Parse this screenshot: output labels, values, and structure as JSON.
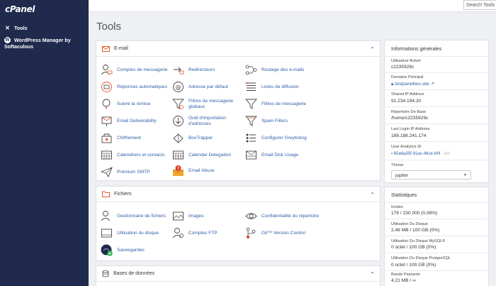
{
  "sidebar": {
    "logo": "cPanel",
    "items": [
      {
        "label": "Tools"
      },
      {
        "label": "WordPress Manager by Softaculous"
      }
    ]
  },
  "search": {
    "text": "Search Tools ("
  },
  "page": {
    "title": "Tools"
  },
  "email_section": {
    "title": "E-mail",
    "tools": [
      "Comptes de messagerie",
      "Redirecteurs",
      "Routage des e-mails",
      "Réponses automatiques",
      "Adresse par défaut",
      "Listes de diffusion",
      "Suivre la remise",
      "Filtres de messagerie globaux",
      "Filtres de messagerie",
      "Email Deliverability",
      "Outil d'importation d'adresses",
      "Spam Filters",
      "Chiffrement",
      "BoxTrapper",
      "Configurer Greylisting",
      "Calendriers et contacts",
      "Calendar Delegation",
      "Email Disk Usage",
      "Premium SMTP",
      "Email Abuse"
    ]
  },
  "files_section": {
    "title": "Fichiers",
    "tools": [
      "Gestionnaire de fichiers",
      "Images",
      "Confidentialité du répertoire",
      "Utilisation du disque",
      "Comptes FTP",
      "Git™ Version Control",
      "Sauvegardes"
    ]
  },
  "db_section": {
    "title": "Bases de données"
  },
  "general_info": {
    "title": "Informations générales",
    "current_user_label": "Utilisateur Actuel",
    "current_user": "c2235929c",
    "primary_domain_label": "Domaine Principal",
    "primary_domain": "testpanellws.site",
    "shared_ip_label": "Shared IP Address",
    "shared_ip": "91.234.194.20",
    "home_dir_label": "Répertoire De Base",
    "home_dir": "/home/c2235929c",
    "last_login_label": "Last Login IP Address",
    "last_login": "188.188.241.174",
    "analytics_label": "User Analytics ID",
    "analytics_id": "60a6a35f-91ac-46ce-bf4",
    "analytics_faded": "- 8ef",
    "theme_label": "Thème",
    "theme": "jupiter"
  },
  "stats": {
    "title": "Statistiques",
    "inodes_label": "Inodes",
    "inodes": "176 / 230 000   (0,08%)",
    "disk_label": "Utilisation Du Disque",
    "disk": "2,46 MB / 100 GB   (0%)",
    "mysql_label": "Utilisation Du Disque MySQL®",
    "mysql": "0 octet / 100 GB   (0%)",
    "pg_label": "Utilisation Du Disque PostgreSQL",
    "pg": "0 octet / 100 GB   (0%)",
    "bw_label": "Bande Passante",
    "bw": "4,21 MB / ∞"
  },
  "colors": {
    "sidebar": "#1f2a4d",
    "link": "#2f5fa8",
    "accent": "#e8542a"
  }
}
